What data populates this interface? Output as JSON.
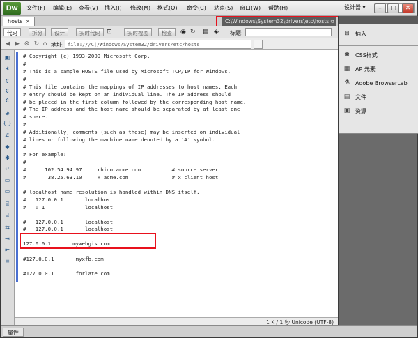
{
  "app": {
    "logo": "Dw"
  },
  "menu": [
    "文件(F)",
    "编辑(E)",
    "查看(V)",
    "插入(I)",
    "修改(M)",
    "格式(O)",
    "命令(C)",
    "站点(S)",
    "窗口(W)",
    "帮助(H)"
  ],
  "workspace": "设计器 ▾",
  "window_buttons": [
    "–",
    "▢",
    "✕"
  ],
  "document": {
    "tab_label": "hosts",
    "path": "C:\\Windows\\System32\\drivers\\etc\\hosts"
  },
  "code_toolbar": {
    "buttons": [
      "代码",
      "拆分",
      "设计",
      "实时代码",
      "实时视图",
      "检查"
    ],
    "title_label": "标题:",
    "title_value": ""
  },
  "address_bar": {
    "label": "地址:",
    "value": "file:///C|/Windows/System32/drivers/etc/hosts"
  },
  "code_lines": [
    "# Copyright (c) 1993-2009 Microsoft Corp.",
    "#",
    "# This is a sample HOSTS file used by Microsoft TCP/IP for Windows.",
    "#",
    "# This file contains the mappings of IP addresses to host names. Each",
    "# entry should be kept on an individual line. The IP address should",
    "# be placed in the first column followed by the corresponding host name.",
    "# The IP address and the host name should be separated by at least one",
    "# space.",
    "#",
    "# Additionally, comments (such as these) may be inserted on individual",
    "# lines or following the machine name denoted by a '#' symbol.",
    "#",
    "# For example:",
    "#",
    "#      102.54.94.97     rhino.acme.com          # source server",
    "#       38.25.63.10     x.acme.com              # x client host",
    "",
    "# localhost name resolution is handled within DNS itself.",
    "#   127.0.0.1       localhost",
    "#   ::1             localhost",
    "",
    "#   127.0.0.1       localhost",
    "#   127.0.0.1       localhost",
    "",
    "127.0.0.1       mywebgis.com",
    "",
    "#127.0.0.1       myxfb.com",
    "",
    "#127.0.0.1       forlate.com"
  ],
  "status": "1 K / 1 秒  Unicode (UTF-8)",
  "properties_tab": "属性",
  "right_panel": {
    "insert_label": "插入",
    "items": [
      "CSS样式",
      "AP 元素",
      "Adobe BrowserLab",
      "文件",
      "资源"
    ]
  },
  "colors": {
    "highlight": "#e8111d",
    "line_marker": "#4a6fd1"
  }
}
